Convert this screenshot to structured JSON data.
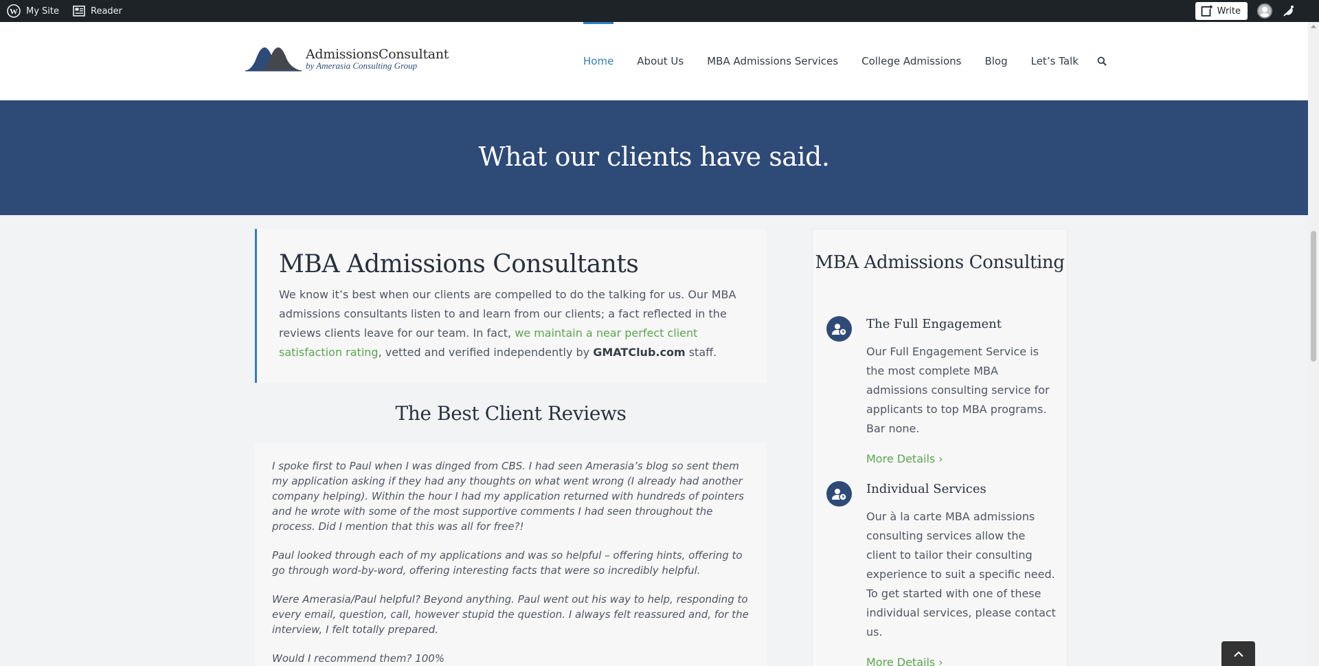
{
  "adminbar": {
    "my_site": "My Site",
    "reader": "Reader",
    "write": "Write"
  },
  "header": {
    "logo_main": "AdmissionsConsultant",
    "logo_sub": "by Amerasia Consulting Group",
    "nav": [
      "Home",
      "About Us",
      "MBA Admissions Services",
      "College Admissions",
      "Blog",
      "Let’s Talk"
    ]
  },
  "banner": {
    "title": "What our clients have said."
  },
  "intro": {
    "title": "MBA Admissions Consultants",
    "text_before": "We know it’s best when our clients are compelled to do the talking for us. Our MBA admissions consultants listen to and learn from our clients; a fact reflected in the reviews clients leave for our team. In fact, ",
    "link": "we maintain a near perfect client satisfaction rating",
    "text_mid": ", vetted and verified independently by ",
    "bold": "GMATClub.com",
    "text_after": " staff."
  },
  "reviews": {
    "title": "The Best Client Reviews",
    "paragraphs": [
      "I spoke first to Paul when I was dinged from CBS. I had seen Amerasia’s blog so sent them my application asking if they had any thoughts on what went wrong (I already had another company helping). Within the hour I had my application returned with hundreds of pointers and he wrote with some of the most supportive comments I had seen throughout the process. Did I mention that this was all for free?!",
      "Paul looked through each of my applications and was so helpful – offering hints, offering to go through word-by-word, offering interesting facts that were so incredibly helpful.",
      "Were Amerasia/Paul helpful? Beyond anything. Paul went out his way to help, responding to every email, question, call, however stupid the question. I always felt reassured and, for the interview, I felt totally prepared.",
      "Would I recommend them? 100%"
    ]
  },
  "sidebar": {
    "title": "MBA Admissions Consulting",
    "services": [
      {
        "title": "The Full Engagement",
        "desc": "Our Full Engagement Service is the most complete MBA admissions consulting service for applicants to top MBA programs. Bar none.",
        "link": "More Details ›"
      },
      {
        "title": "Individual Services",
        "desc": "Our à la carte MBA admissions consulting services allow the client to tailor their consulting experience to suit a specific need. To get started with one of these individual services, please contact us.",
        "link": "More Details ›"
      }
    ]
  },
  "colors": {
    "navy": "#2e4a77",
    "accent_blue": "#2f7fbf",
    "link_green": "#5aa54c",
    "adminbar": "#1d2327"
  }
}
